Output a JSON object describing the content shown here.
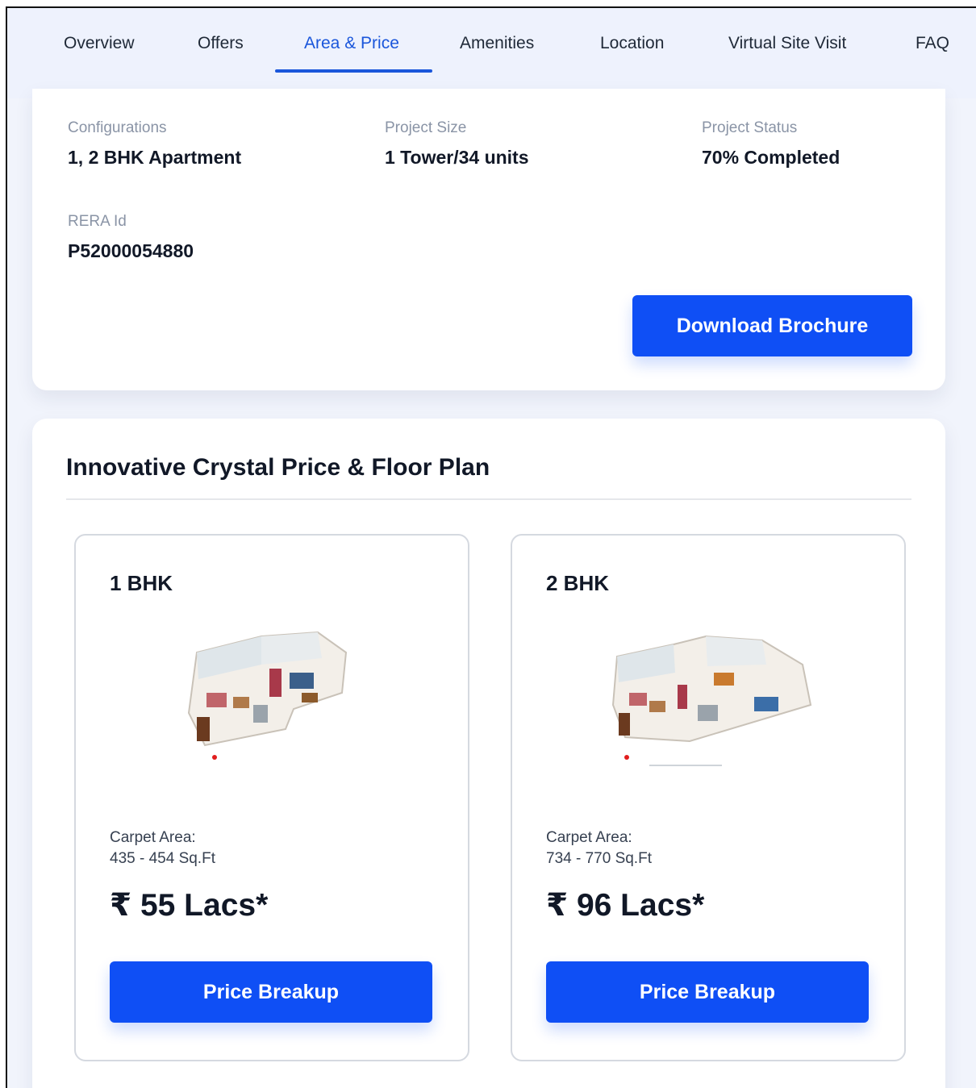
{
  "tabs": [
    {
      "label": "Overview"
    },
    {
      "label": "Offers"
    },
    {
      "label": "Area & Price"
    },
    {
      "label": "Amenities"
    },
    {
      "label": "Location"
    },
    {
      "label": "Virtual Site Visit"
    },
    {
      "label": "FAQ"
    }
  ],
  "active_tab": "Area & Price",
  "info": {
    "configurations_label": "Configurations",
    "configurations_value": "1, 2 BHK Apartment",
    "project_size_label": "Project Size",
    "project_size_value": "1 Tower/34 units",
    "project_status_label": "Project Status",
    "project_status_value": "70% Completed",
    "rera_label": "RERA Id",
    "rera_value": "P52000054880",
    "download_label": "Download Brochure"
  },
  "floor_plan": {
    "title": "Innovative Crystal Price & Floor Plan",
    "units": [
      {
        "name": "1 BHK",
        "area_label": "Carpet Area:",
        "area_value": "435 - 454 Sq.Ft",
        "price": "₹ 55 Lacs*",
        "button_label": "Price Breakup"
      },
      {
        "name": "2 BHK",
        "area_label": "Carpet Area:",
        "area_value": "734 - 770 Sq.Ft",
        "price": "₹ 96 Lacs*",
        "button_label": "Price Breakup"
      }
    ]
  },
  "colors": {
    "accent": "#0f4ff5",
    "active_tab": "#1a56db",
    "background": "#f1f4fc"
  }
}
